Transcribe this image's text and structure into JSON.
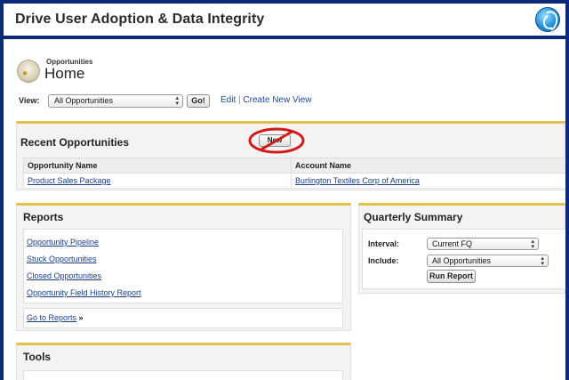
{
  "banner": {
    "title": "Drive User Adoption & Data Integrity",
    "logo_icon": "globe-logo-icon"
  },
  "header": {
    "object_type": "Opportunities",
    "title": "Home",
    "icon": "opportunity-coins-icon"
  },
  "view_bar": {
    "label": "View:",
    "selected": "All Opportunities",
    "go_label": "Go!",
    "edit_link": "Edit",
    "separator": "|",
    "create_link": "Create New View"
  },
  "recent": {
    "title": "Recent Opportunities",
    "new_label": "New",
    "columns": [
      "Opportunity Name",
      "Account Name"
    ],
    "rows": [
      {
        "name": "Product Sales Package",
        "account": "Burlington Textiles Corp of America"
      }
    ]
  },
  "reports": {
    "title": "Reports",
    "items": [
      "Opportunity Pipeline",
      "Stuck Opportunities",
      "Closed Opportunities",
      "Opportunity Field History Report"
    ],
    "go_link": "Go to Reports",
    "go_arrow": "»"
  },
  "summary": {
    "title": "Quarterly Summary",
    "interval_label": "Interval:",
    "interval_value": "Current FQ",
    "include_label": "Include:",
    "include_value": "All Opportunities",
    "run_label": "Run Report"
  },
  "tools": {
    "title": "Tools"
  },
  "colors": {
    "frame": "#0b2a78",
    "accent": "#e1c24a",
    "link": "#1a3f86",
    "no_sign": "#d11a1a"
  }
}
